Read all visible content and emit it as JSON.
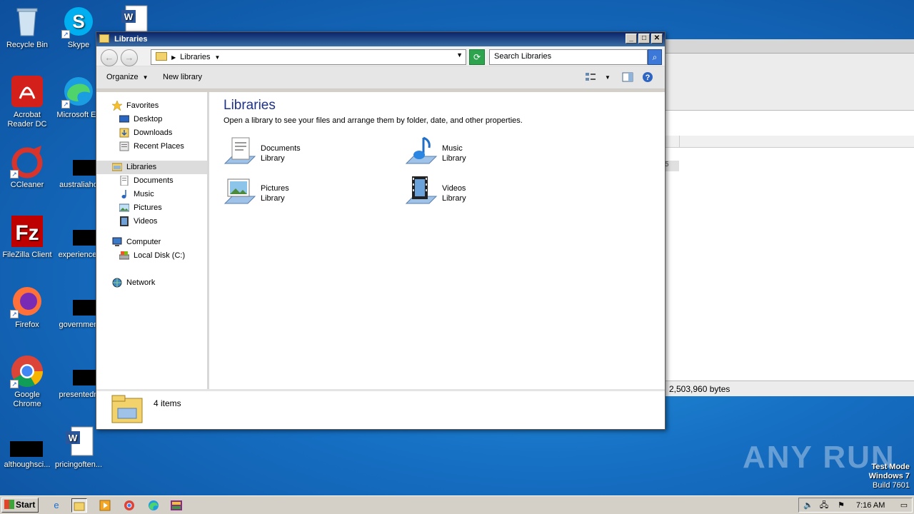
{
  "desktop": {
    "icons": [
      {
        "label": "Recycle Bin"
      },
      {
        "label": "Skype"
      },
      {
        "label": "Acrobat Reader DC"
      },
      {
        "label": "Microsoft Ed"
      },
      {
        "label": "CCleaner"
      },
      {
        "label": "australiaho"
      },
      {
        "label": "FileZilla Client"
      },
      {
        "label": "experiencef"
      },
      {
        "label": "Firefox"
      },
      {
        "label": "governmen"
      },
      {
        "label": "Google Chrome"
      },
      {
        "label": "presentedri"
      },
      {
        "label": "althoughsci..."
      },
      {
        "label": "pricingoften..."
      }
    ]
  },
  "background_window": {
    "status_text": "2,503,960 bytes",
    "cell_fragment": "5"
  },
  "explorer": {
    "title": "Libraries",
    "address": "Libraries",
    "search_placeholder": "Search Libraries",
    "commands": {
      "organize": "Organize",
      "new_library": "New library"
    },
    "nav": {
      "favorites": "Favorites",
      "desktop": "Desktop",
      "downloads": "Downloads",
      "recent_places": "Recent Places",
      "libraries": "Libraries",
      "documents": "Documents",
      "music": "Music",
      "pictures": "Pictures",
      "videos": "Videos",
      "computer": "Computer",
      "local_disk": "Local Disk (C:)",
      "network": "Network"
    },
    "content": {
      "heading": "Libraries",
      "description": "Open a library to see your files and arrange them by folder, date, and other properties.",
      "libraries": [
        {
          "name": "Documents",
          "type": "Library"
        },
        {
          "name": "Music",
          "type": "Library"
        },
        {
          "name": "Pictures",
          "type": "Library"
        },
        {
          "name": "Videos",
          "type": "Library"
        }
      ]
    },
    "status": "4 items"
  },
  "watermark": {
    "text": "ANY RUN",
    "mode": "Test Mode",
    "os": "Windows 7",
    "build": "Build 7601"
  },
  "taskbar": {
    "start_label": "Start",
    "clock": "7:16 AM"
  },
  "colors": {
    "title_gradient_start": "#0a246a",
    "title_gradient_end": "#3a6ea5",
    "heading_blue": "#1e3287",
    "desktop_blue": "#1670c4"
  }
}
